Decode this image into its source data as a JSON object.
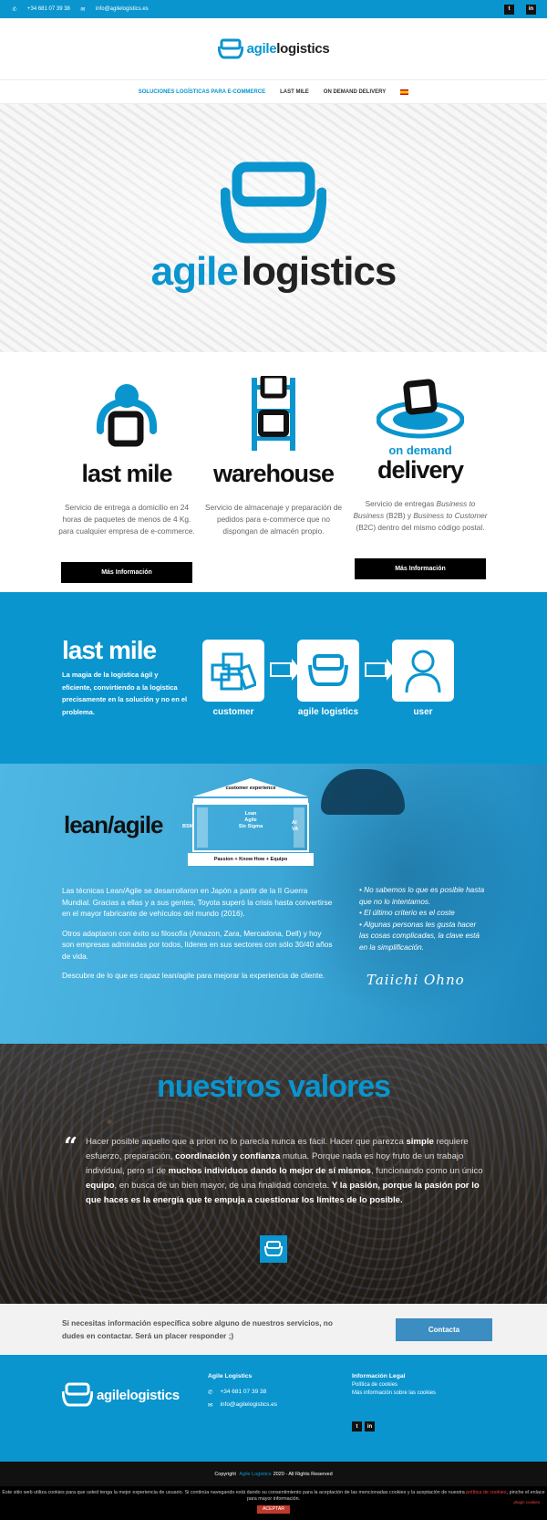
{
  "topbar": {
    "phone": "+34 681 07 39 38",
    "email": "info@agilelogistics.es",
    "social": [
      "twitter",
      "linkedin"
    ]
  },
  "brand": {
    "name_part1": "agile",
    "name_part2": "logistics",
    "accent_color": "#0a95cf"
  },
  "nav": {
    "items": [
      {
        "label": "SOLUCIONES LOGÍSTICAS PARA E-COMMERCE",
        "active": true
      },
      {
        "label": "LAST MILE",
        "active": false
      },
      {
        "label": "ON DEMAND DELIVERY",
        "active": false
      }
    ],
    "language": "ES"
  },
  "services": [
    {
      "title": "last mile",
      "subtitle": "",
      "icon": "person-box-icon",
      "text": "Servicio de entrega a domicilio en 24 horas de paquetes de menos de 4 Kg. para cualquier empresa de e-commerce.",
      "button": "Más Información"
    },
    {
      "title": "warehouse",
      "subtitle": "",
      "icon": "shelf-icon",
      "text": "Servicio de almacenaje y preparación de pedidos para e-commerce que no dispongan de almacén propio.",
      "button": ""
    },
    {
      "title": "delivery",
      "subtitle": "on demand",
      "icon": "delivery-ripple-icon",
      "text": "Servicio de entregas Business to Business (B2B) y Business to Customer (B2C) dentro del mismo código postal.",
      "button": "Más Información"
    }
  ],
  "lastmile": {
    "title": "last mile",
    "text": "La magia de la logística ágil y eficiente, convirtiendo a la logística precisamente en la solución y no en el problema.",
    "flow": [
      "customer",
      "agile logistics",
      "user"
    ]
  },
  "lean": {
    "title": "lean/agile",
    "temple": {
      "roof": "customer experience",
      "left": "BSM",
      "center": [
        "Lean",
        "Agile",
        "Six Sigma"
      ],
      "right": [
        "AI",
        "VA"
      ],
      "base": "Passion + Know How + Equipo"
    },
    "paragraphs": [
      "Las técnicas Lean/Agile se desarrollaron en Japón a partir de la II Guerra Mundial. Gracias a ellas y a sus gentes, Toyota superó la crisis hasta convertirse en el mayor fabricante de vehículos del mundo (2016).",
      "Otros adaptaron con éxito su filosofía (Amazon, Zara, Mercadona, Dell) y hoy son empresas admiradas por todos, líderes en sus sectores con sólo 30/40 años de vida.",
      "Descubre de lo que es capaz lean/agile para mejorar la experiencia de cliente."
    ],
    "quotes": [
      "No sabemos lo que es posible hasta que no lo intentamos.",
      "El último criterio es el coste",
      "Algunas personas les gusta hacer las cosas complicadas, la clave está en la simplificación."
    ],
    "signature": "Taiichi Ohno"
  },
  "valores": {
    "title": "nuestros valores",
    "quote_html_parts": {
      "p1": "Hacer posible aquello que a priori no lo parecía nunca es fácil. Hacer que parezca ",
      "b1": "simple",
      "p2": " requiere esfuerzo, preparación, ",
      "b2": "coordinación y confianza",
      "p3": " mutua. Porque nada es hoy fruto de un trabajo individual, pero sí de ",
      "b3": "muchos individuos dando lo mejor de sí mismos",
      "p4": ", funcionando como un único ",
      "b4": "equipo",
      "p5": ", en busca de un bien mayor, de una finalidad concreta. ",
      "b5": "Y la pasión, porque la pasión por lo que haces es la energía que te empuja a cuestionar los límites de lo posible."
    }
  },
  "contact": {
    "text": "Si necesitas información específica sobre alguno de nuestros servicios, no dudes en contactar. Será un placer responder ;)",
    "button": "Contacta"
  },
  "footer": {
    "col2_title": "Agile Logistics",
    "phone": "+34 681 07 39 38",
    "email": "info@agilelogistics.es",
    "col3_title": "Información Legal",
    "legal_links": [
      "Política de cookies",
      "Más información sobre las cookies"
    ]
  },
  "copyright": {
    "prefix": "Copyright",
    "link": "Agile Logistics",
    "suffix": "2020 - All Rights Reserved"
  },
  "cookie": {
    "text1": "Este sitio web utiliza cookies para que usted tenga la mejor experiencia de usuario. Si continúa navegando está dando su consentimiento para la aceptación de las mencionadas cookies y la aceptación de nuestra",
    "link": "política de cookies",
    "text2": ", pinche el enlace para mayor información.",
    "button": "ACEPTAR",
    "plugin": "plugin cookies"
  }
}
